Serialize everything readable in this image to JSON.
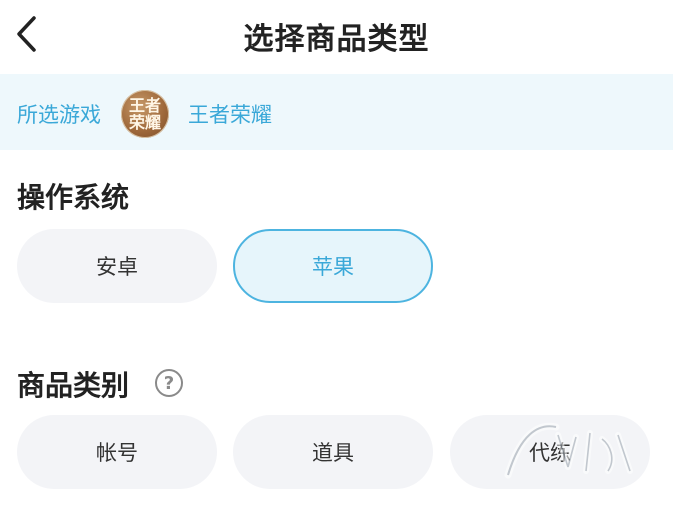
{
  "header": {
    "title": "选择商品类型"
  },
  "selected_game": {
    "label": "所选游戏",
    "avatar_text": [
      "王者",
      "荣耀"
    ],
    "name": "王者荣耀"
  },
  "os_section": {
    "title": "操作系统",
    "options": [
      "安卓",
      "苹果"
    ],
    "selected": "苹果"
  },
  "category_section": {
    "title": "商品类别",
    "help_glyph": "?",
    "options": [
      "帐号",
      "道具",
      "代练"
    ]
  },
  "colors": {
    "accent": "#3aa8d8",
    "strip_bg": "#eef8fc",
    "pill_bg": "#f3f4f7",
    "selected_bg": "#e6f5fb"
  }
}
